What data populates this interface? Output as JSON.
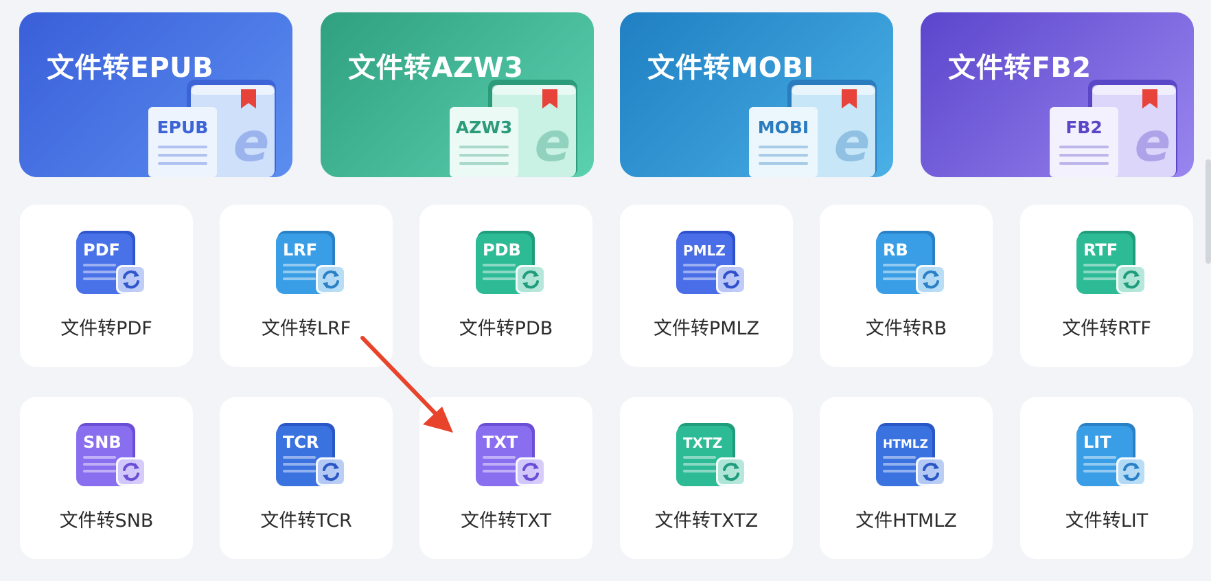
{
  "banners": [
    {
      "title": "文件转EPUB",
      "doc_label": "EPUB",
      "color_a": "#3a5fd9",
      "color_b": "#5b8ef0",
      "accent": "#3d64d6",
      "pale": "#cfe0fb"
    },
    {
      "title": "文件转AZW3",
      "doc_label": "AZW3",
      "color_a": "#2fa080",
      "color_b": "#5bd1b0",
      "accent": "#2b9b7a",
      "pale": "#c9f1e4"
    },
    {
      "title": "文件转MOBI",
      "doc_label": "MOBI",
      "color_a": "#1f7fc2",
      "color_b": "#4ab0e6",
      "accent": "#2b7bbf",
      "pale": "#c7e7f8"
    },
    {
      "title": "文件转FB2",
      "doc_label": "FB2",
      "color_a": "#5b45cc",
      "color_b": "#9a86ef",
      "accent": "#5a47c8",
      "pale": "#ddd6fb"
    }
  ],
  "tiles_row1": [
    {
      "label": "文件转PDF",
      "icon_text": "PDF",
      "color": "#4a72e8",
      "dark": "#2f56cc"
    },
    {
      "label": "文件转LRF",
      "icon_text": "LRF",
      "color": "#3a9ee6",
      "dark": "#2a80c6"
    },
    {
      "label": "文件转PDB",
      "icon_text": "PDB",
      "color": "#2dbb96",
      "dark": "#1f9c7c"
    },
    {
      "label": "文件转PMLZ",
      "icon_text": "PMLZ",
      "color": "#4a6ee8",
      "dark": "#2f50cc"
    },
    {
      "label": "文件转RB",
      "icon_text": "RB",
      "color": "#3a9ee6",
      "dark": "#2a80c6"
    },
    {
      "label": "文件转RTF",
      "icon_text": "RTF",
      "color": "#2dbb96",
      "dark": "#1f9c7c"
    }
  ],
  "tiles_row2": [
    {
      "label": "文件转SNB",
      "icon_text": "SNB",
      "color": "#8a6ef0",
      "dark": "#6a4fd6"
    },
    {
      "label": "文件转TCR",
      "icon_text": "TCR",
      "color": "#3a72e0",
      "dark": "#2a56c6"
    },
    {
      "label": "文件转TXT",
      "icon_text": "TXT",
      "color": "#8a6ef0",
      "dark": "#6a4fd6"
    },
    {
      "label": "文件转TXTZ",
      "icon_text": "TXTZ",
      "color": "#2dbb96",
      "dark": "#1f9c7c"
    },
    {
      "label": "文件HTMLZ",
      "icon_text": "HTMLZ",
      "color": "#3a72e0",
      "dark": "#2a56c6"
    },
    {
      "label": "文件转LIT",
      "icon_text": "LIT",
      "color": "#3a9ee6",
      "dark": "#2a80c6"
    }
  ],
  "annotation": {
    "arrow_color": "#e8432b"
  }
}
